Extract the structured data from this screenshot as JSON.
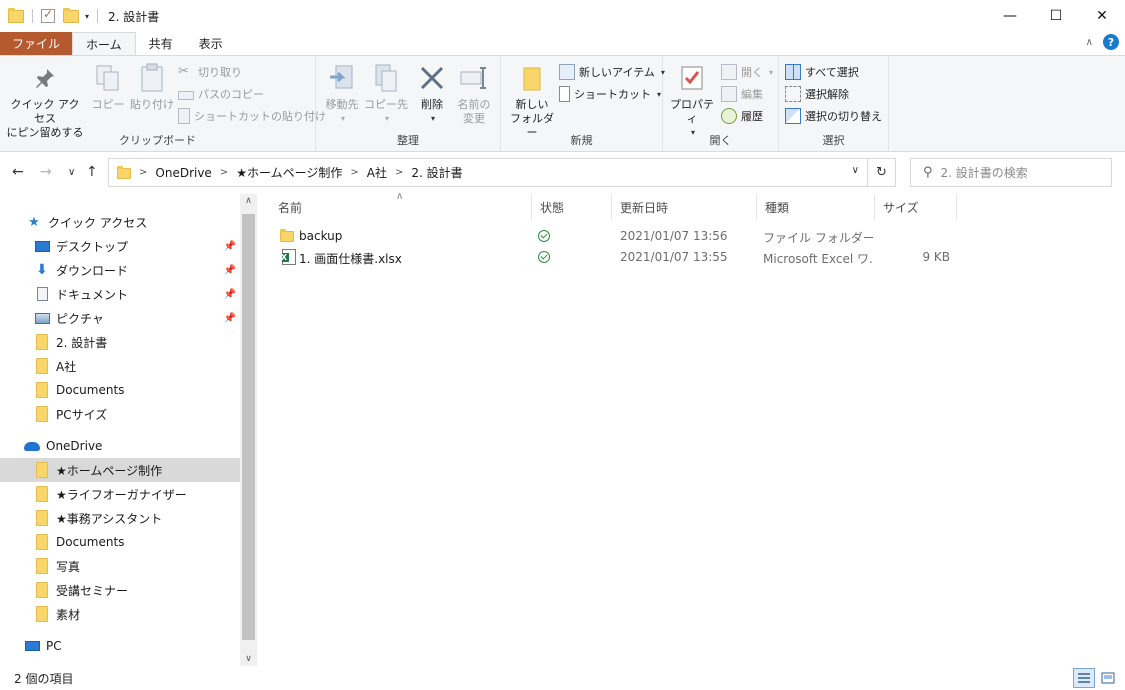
{
  "window": {
    "title": "2. 設計書",
    "minimize": "—",
    "maximize": "☐",
    "close": "✕"
  },
  "ribbon_tabs": [
    "ファイル",
    "ホーム",
    "共有",
    "表示"
  ],
  "ribbon": {
    "clipboard": {
      "label": "クリップボード",
      "pin_quick_access_1": "クイック アクセス",
      "pin_quick_access_2": "にピン留めする",
      "copy": "コピー",
      "paste": "貼り付け",
      "cut": "切り取り",
      "copy_path": "パスのコピー",
      "paste_shortcut": "ショートカットの貼り付け"
    },
    "organize": {
      "label": "整理",
      "move_to": "移動先",
      "copy_to": "コピー先",
      "delete": "削除",
      "rename_1": "名前の",
      "rename_2": "変更"
    },
    "new": {
      "label": "新規",
      "new_folder_1": "新しい",
      "new_folder_2": "フォルダー",
      "new_item": "新しいアイテム",
      "easy_access": "ショートカット"
    },
    "open": {
      "label": "開く",
      "properties": "プロパティ",
      "open": "開く",
      "edit": "編集",
      "history": "履歴"
    },
    "select": {
      "label": "選択",
      "select_all": "すべて選択",
      "select_none": "選択解除",
      "invert": "選択の切り替え"
    }
  },
  "address": {
    "segments": [
      "OneDrive",
      "★ホームページ制作",
      "A社",
      "2. 設計書"
    ],
    "search_placeholder": "2. 設計書の検索"
  },
  "nav_pane": {
    "quick_access": "クイック アクセス",
    "quick_items": [
      {
        "label": "デスクトップ",
        "icon": "desktop-icon",
        "pinned": true
      },
      {
        "label": "ダウンロード",
        "icon": "download-icon",
        "pinned": true
      },
      {
        "label": "ドキュメント",
        "icon": "document-icon",
        "pinned": true
      },
      {
        "label": "ピクチャ",
        "icon": "picture-icon",
        "pinned": true
      },
      {
        "label": "2. 設計書",
        "icon": "folder-icon",
        "pinned": false
      },
      {
        "label": "A社",
        "icon": "folder-icon",
        "pinned": false
      },
      {
        "label": "Documents",
        "icon": "folder-icon",
        "pinned": false
      },
      {
        "label": "PCサイズ",
        "icon": "folder-icon",
        "pinned": false
      }
    ],
    "onedrive": "OneDrive",
    "onedrive_items": [
      {
        "label": "★ホームページ制作",
        "selected": true
      },
      {
        "label": "★ライフオーガナイザー",
        "selected": false
      },
      {
        "label": "★事務アシスタント",
        "selected": false
      },
      {
        "label": "Documents",
        "selected": false
      },
      {
        "label": "写真",
        "selected": false
      },
      {
        "label": "受講セミナー",
        "selected": false
      },
      {
        "label": "素材",
        "selected": false
      }
    ],
    "pc": "PC"
  },
  "file_list": {
    "columns": [
      "名前",
      "状態",
      "更新日時",
      "種類",
      "サイズ"
    ],
    "rows": [
      {
        "name": "backup",
        "icon": "folder-icon",
        "modified": "2021/01/07 13:56",
        "type": "ファイル フォルダー",
        "size": ""
      },
      {
        "name": "1. 画面仕様書.xlsx",
        "icon": "excel-icon",
        "modified": "2021/01/07 13:55",
        "type": "Microsoft Excel ワ...",
        "size": "9 KB"
      }
    ]
  },
  "status_bar": {
    "count": "2 個の項目"
  },
  "colors": {
    "file_tab": "#b55a2e",
    "accent": "#1979ca",
    "sync_ok": "#2a8f3a"
  }
}
